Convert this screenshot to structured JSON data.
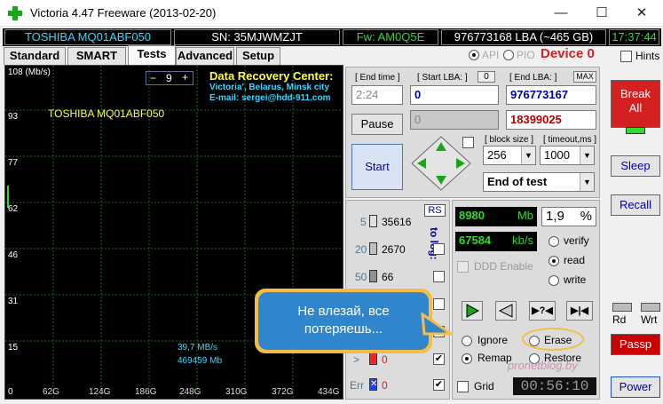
{
  "window": {
    "title": "Victoria 4.47   Freeware (2013-02-20)"
  },
  "info": {
    "model": "TOSHIBA MQ01ABF050",
    "serial": "SN: 35MJWMZJT",
    "firmware": "Fw: AM0Q5E",
    "lba": "976773168 LBA (~465 GB)",
    "time": "17:37:44"
  },
  "mode": {
    "api": "API",
    "pio": "PIO",
    "device": "Device 0",
    "hints": "Hints"
  },
  "tabs": [
    "Standard",
    "SMART",
    "Tests",
    "Advanced",
    "Setup"
  ],
  "graph": {
    "unit": "108 (Mb/s)",
    "y_labels": [
      "93",
      "77",
      "62",
      "46",
      "31",
      "15",
      "0"
    ],
    "x_labels": [
      "62G",
      "124G",
      "186G",
      "248G",
      "310G",
      "372G",
      "434G"
    ],
    "drive": "TOSHIBA MQ01ABF050",
    "zoom": "9",
    "minus": "−",
    "plus": "+",
    "speed": "39,7 MB/s",
    "kb": "469459 Mb"
  },
  "promo": {
    "line1": "Data Recovery Center:",
    "line2": "Victoria', Belarus, Minsk city",
    "line3": "E-mail: sergei@hdd-911.com"
  },
  "controls": {
    "end_time_label": "[ End time ]",
    "end_time": "2:24",
    "start_lba_label": "[ Start LBA: ]",
    "start_lba_zero": "0",
    "start_lba": "0",
    "end_lba_label": "[ End LBA: ]",
    "end_lba_max": "MAX",
    "end_lba": "976773167",
    "current_lba": "0",
    "remaining": "18399025",
    "pause": "Pause",
    "start": "Start",
    "block_size_label": "[ block size ]",
    "block_size": "256",
    "timeout_label": "[ timeout,ms ]",
    "timeout": "1000",
    "end_action": "End of test"
  },
  "blocks": {
    "rs": "RS",
    "to_log": "to log:",
    "rows": [
      {
        "level": "5",
        "count": "35616",
        "color": "#e0e0e0"
      },
      {
        "level": "20",
        "count": "2670",
        "color": "#c0c0c0"
      },
      {
        "level": "50",
        "count": "66",
        "color": "#909090"
      },
      {
        "level": ">",
        "count": "0",
        "color": "#ff2020"
      },
      {
        "level": "Err",
        "count": "0",
        "color": "#2040ff"
      }
    ]
  },
  "stats": {
    "mb": "8980",
    "mb_unit": "Mb",
    "percent": "1,9",
    "percent_unit": "%",
    "kbs": "67584",
    "kbs_unit": "kb/s",
    "ddd": "DDD Enable",
    "verify": "verify",
    "read": "read",
    "write": "write",
    "ignore": "Ignore",
    "erase": "Erase",
    "remap": "Remap",
    "restore": "Restore",
    "grid": "Grid",
    "clock": "00:56:10"
  },
  "side": {
    "break": "Break\nAll",
    "sleep": "Sleep",
    "recall": "Recall",
    "rd": "Rd",
    "wrt": "Wrt",
    "passp": "Passp",
    "power": "Power"
  },
  "callout": {
    "text": "Не влезай, все\nпотеряешь..."
  },
  "watermark": "pronetblog.by",
  "colors": {
    "accent_red": "#d42020",
    "lcd_green": "#2fdc2f",
    "callout_blue": "#2f86cc",
    "callout_border": "#f5bd47"
  }
}
